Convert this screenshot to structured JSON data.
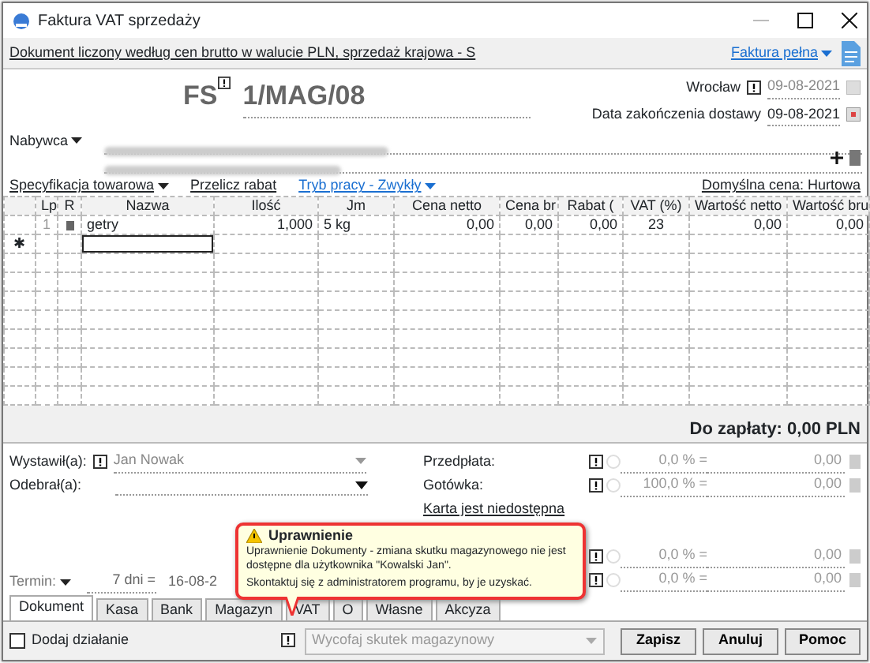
{
  "window": {
    "title": "Faktura VAT sprzedaży"
  },
  "info_bar": {
    "text": "Dokument liczony według cen brutto w walucie PLN, sprzedaż krajowa - S",
    "invoice_type": "Faktura pełna"
  },
  "header": {
    "doc_type": "FS",
    "number": "1/MAG/08",
    "place": "Wrocław",
    "issue_date": "09-08-2021",
    "delivery_label": "Data zakończenia dostawy",
    "delivery_date": "09-08-2021",
    "buyer_label": "Nabywca"
  },
  "toolbar": {
    "spec": "Specyfikacja towarowa",
    "recalc": "Przelicz rabat",
    "mode": "Tryb pracy - Zwykły",
    "default_price": "Domyślna cena: Hurtowa"
  },
  "table": {
    "columns": [
      "Lp",
      "R",
      "Nazwa",
      "Ilość",
      "Jm",
      "Cena netto",
      "Cena br",
      "Rabat (",
      "VAT (%)",
      "Wartość netto",
      "Wartość bru"
    ],
    "rows": [
      {
        "lp": "1",
        "name": "getry",
        "qty": "1,000",
        "unit": "5 kg",
        "net_price": "0,00",
        "gross_price": "0,00",
        "discount": "0,00",
        "vat": "23",
        "net_value": "0,00",
        "gross_value": "0,00"
      }
    ],
    "new_row_marker": "✱"
  },
  "total": "Do zapłaty: 0,00 PLN",
  "issuer": {
    "label": "Wystawił(a):",
    "value": "Jan Nowak"
  },
  "receiver": {
    "label": "Odebrał(a):"
  },
  "payments": [
    {
      "label": "Przedpłata:",
      "percent": "0,0 % =",
      "amount": "0,00",
      "selected": false
    },
    {
      "label": "Gotówka:",
      "percent": "100,0 % =",
      "amount": "0,00",
      "selected": false
    },
    {
      "percent": "0,0 % =",
      "amount": "0,00",
      "selected": false
    },
    {
      "percent": "0,0 % =",
      "amount": "0,00",
      "selected": false
    }
  ],
  "card_link": "Karta jest niedostępna",
  "term": {
    "label": "Termin:",
    "days": "7 dni =",
    "date": "16-08-2"
  },
  "tabs": [
    {
      "label": "Dokument",
      "selected": true
    },
    {
      "label": "Kasa",
      "selected": false
    },
    {
      "label": "Bank",
      "selected": false
    },
    {
      "label": "Magazyn",
      "selected": false
    },
    {
      "label": "VAT",
      "selected": false
    },
    {
      "label": "O",
      "selected": false
    },
    {
      "label": "Własne",
      "selected": false
    },
    {
      "label": "Akcyza",
      "selected": false
    }
  ],
  "add_action": {
    "label": "Dodaj działanie",
    "checked": false
  },
  "stock_action": {
    "value": "Wycofaj skutek magazynowy",
    "disabled": true
  },
  "buttons": [
    "Zapisz",
    "Anuluj",
    "Pomoc"
  ],
  "tooltip": {
    "title": "Uprawnienie",
    "message": "Uprawnienie Dokumenty - zmiana skutku magazynowego nie jest dostępne dla użytkownika \"Kowalski Jan\".",
    "hint": "Skontaktuj się z administratorem programu, by je uzyskać."
  }
}
